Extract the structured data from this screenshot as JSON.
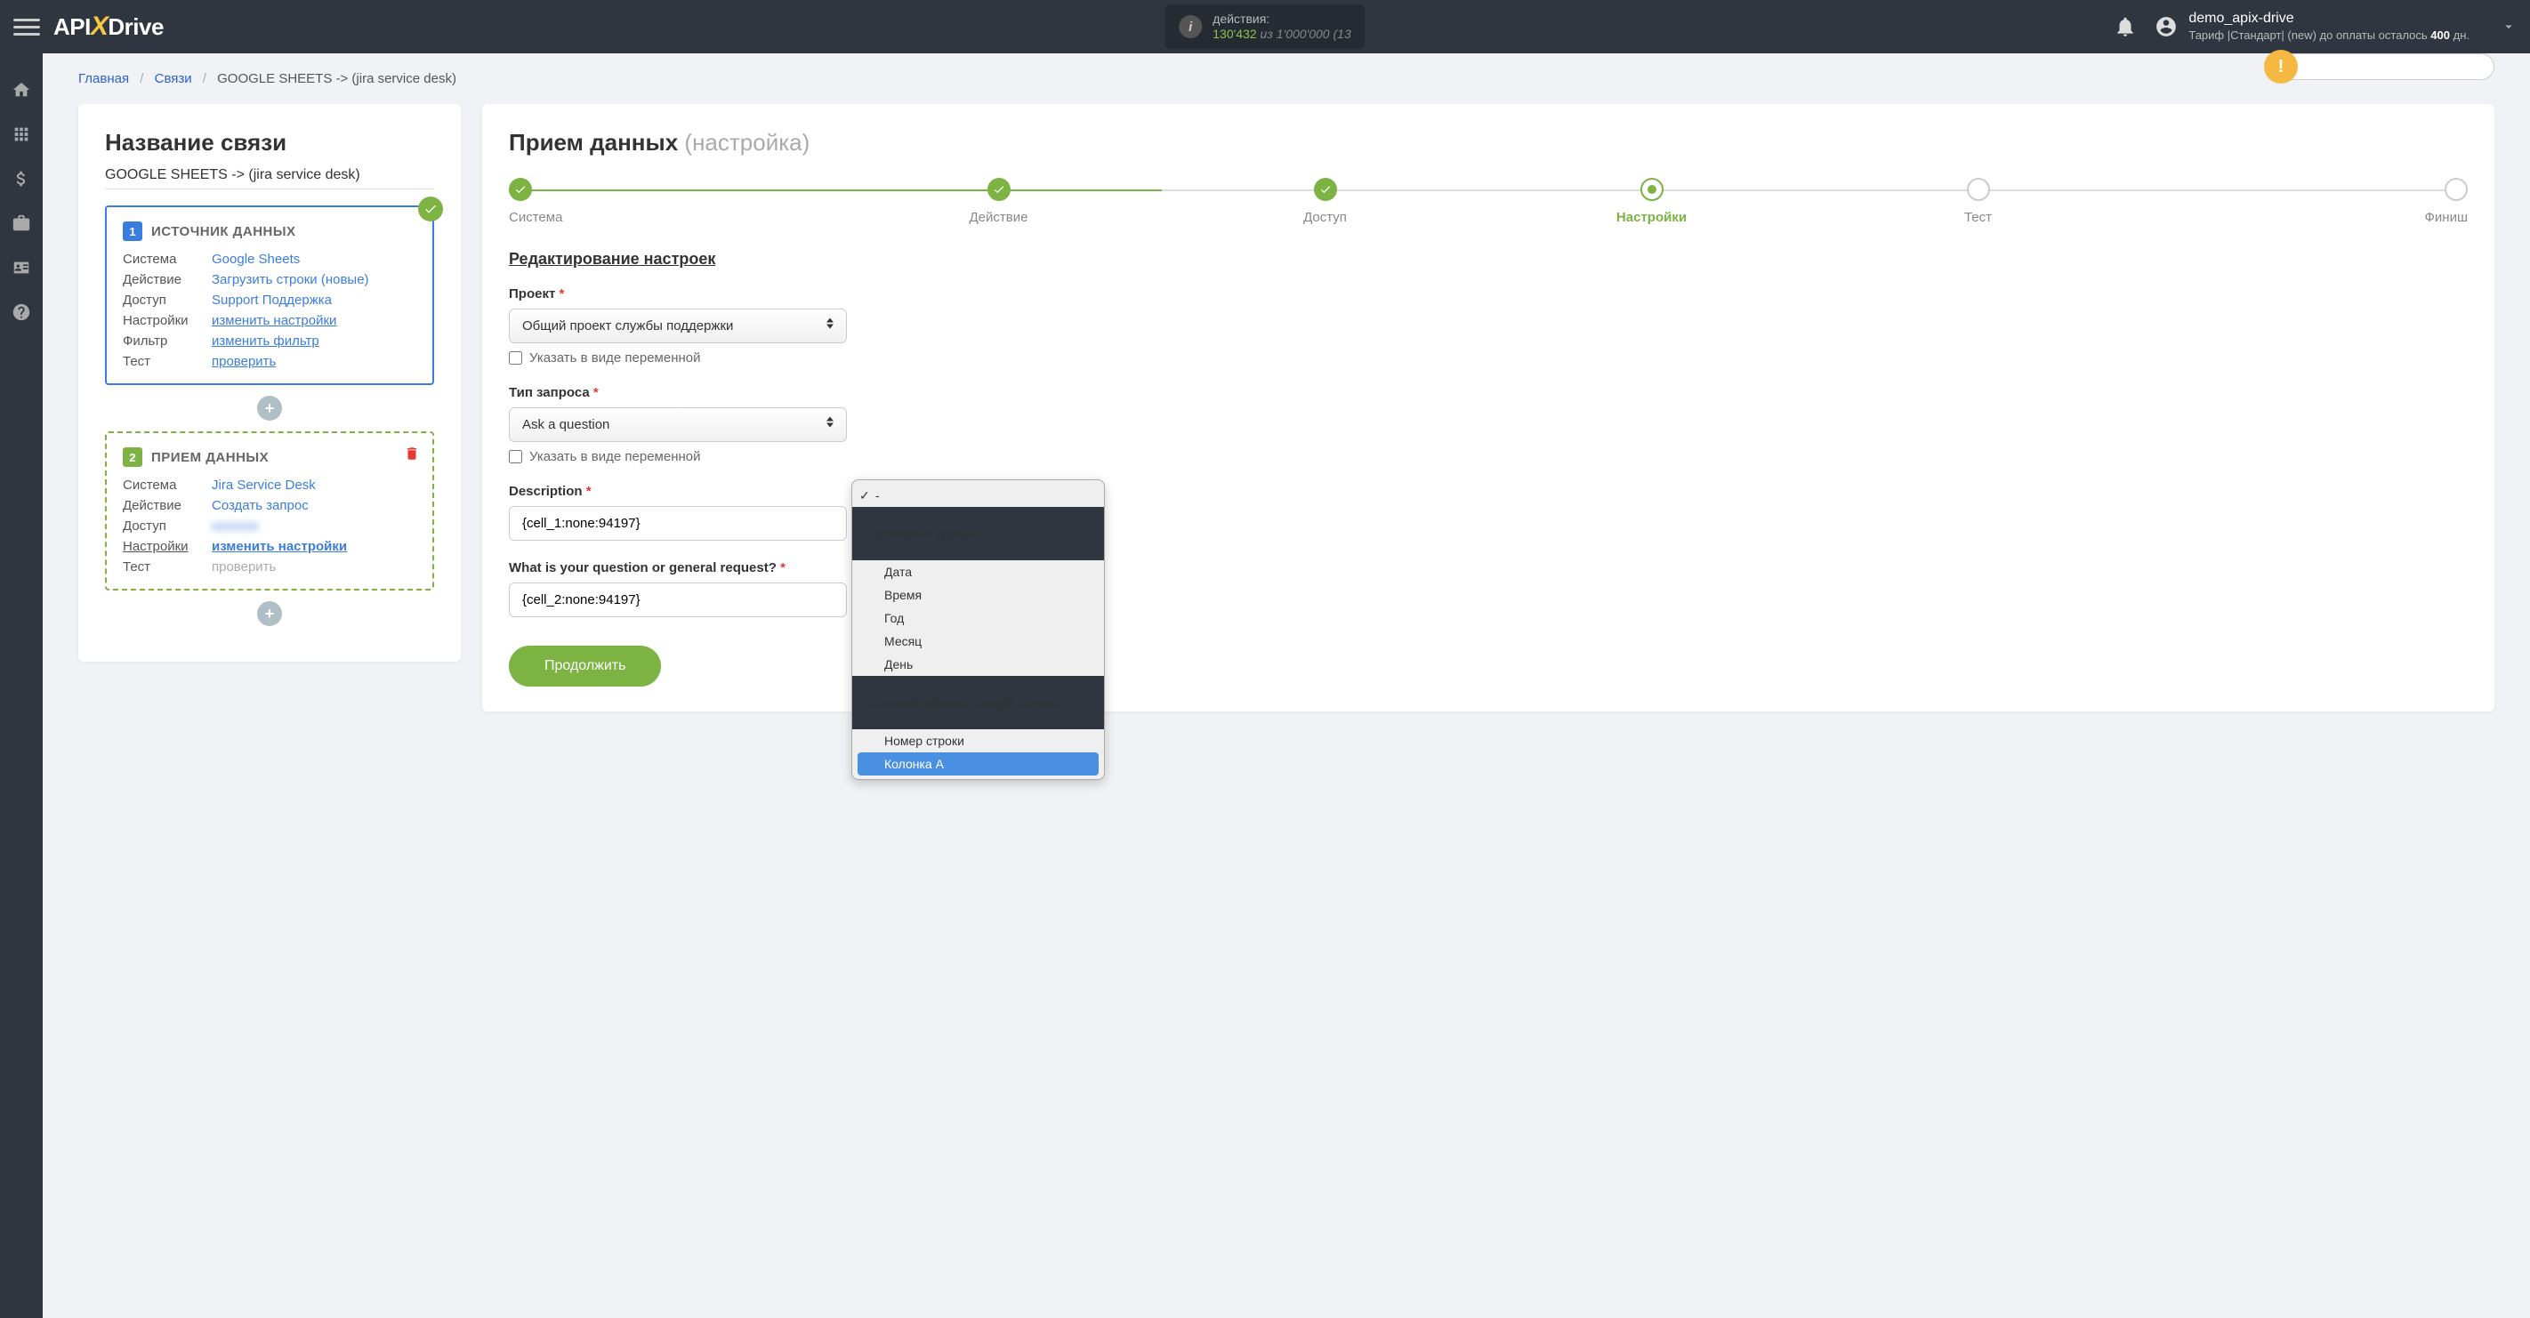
{
  "header": {
    "logo_part1": "API",
    "logo_x": "X",
    "logo_part2": "Drive",
    "actions_label": "действия:",
    "actions_count": "130'432",
    "actions_of": "из",
    "actions_total": "1'000'000",
    "actions_paren": "(13",
    "username": "demo_apix-drive",
    "tariff_prefix": "Тариф |Стандарт| (new) до оплаты осталось ",
    "tariff_days": "400",
    "tariff_suffix": " дн."
  },
  "breadcrumb": {
    "home": "Главная",
    "links": "Связи",
    "current": "GOOGLE SHEETS -> (jira service desk)"
  },
  "left": {
    "title": "Название связи",
    "connection_name": "GOOGLE SHEETS -> (jira service desk)",
    "block1": {
      "num": "1",
      "title": "ИСТОЧНИК ДАННЫХ",
      "rows": [
        {
          "label": "Система",
          "value": "Google Sheets"
        },
        {
          "label": "Действие",
          "value": "Загрузить строки (новые)"
        },
        {
          "label": "Доступ",
          "value": "Support Поддержка"
        },
        {
          "label": "Настройки",
          "value": "изменить настройки"
        },
        {
          "label": "Фильтр",
          "value": "изменить фильтр"
        },
        {
          "label": "Тест",
          "value": "проверить"
        }
      ]
    },
    "block2": {
      "num": "2",
      "title": "ПРИЕМ ДАННЫХ",
      "rows": [
        {
          "label": "Система",
          "value": "Jira Service Desk"
        },
        {
          "label": "Действие",
          "value": "Создать запрос"
        },
        {
          "label": "Доступ",
          "value": "blurred"
        },
        {
          "label": "Настройки",
          "value": "изменить настройки"
        },
        {
          "label": "Тест",
          "value": "проверить"
        }
      ]
    }
  },
  "right": {
    "title": "Прием данных",
    "subtitle": "(настройка)",
    "steps": [
      {
        "label": "Система",
        "state": "done"
      },
      {
        "label": "Действие",
        "state": "done"
      },
      {
        "label": "Доступ",
        "state": "done"
      },
      {
        "label": "Настройки",
        "state": "active"
      },
      {
        "label": "Тест",
        "state": "inactive"
      },
      {
        "label": "Финиш",
        "state": "inactive"
      }
    ],
    "section_title": "Редактирование настроек",
    "fields": {
      "project_label": "Проект",
      "project_value": "Общий проект службы поддержки",
      "variable_checkbox": "Указать в виде переменной",
      "request_type_label": "Тип запроса",
      "request_type_value": "Ask a question",
      "description_label": "Description",
      "description_value": "{cell_1:none:94197}",
      "question_label": "What is your question or general request?",
      "question_value": "{cell_2:none:94197}"
    },
    "continue_button": "Продолжить",
    "dropdown": {
      "items": [
        {
          "text": "-",
          "type": "checked"
        },
        {
          "text": "Системные данные",
          "type": "header"
        },
        {
          "text": "Дата",
          "type": "sub"
        },
        {
          "text": "Время",
          "type": "sub"
        },
        {
          "text": "Год",
          "type": "sub"
        },
        {
          "text": "Месяц",
          "type": "sub"
        },
        {
          "text": "День",
          "type": "sub"
        },
        {
          "text": "Источник данных (Google Sheets)",
          "type": "header"
        },
        {
          "text": "Номер строки",
          "type": "sub"
        },
        {
          "text": "Колонка А",
          "type": "highlighted"
        }
      ]
    }
  }
}
